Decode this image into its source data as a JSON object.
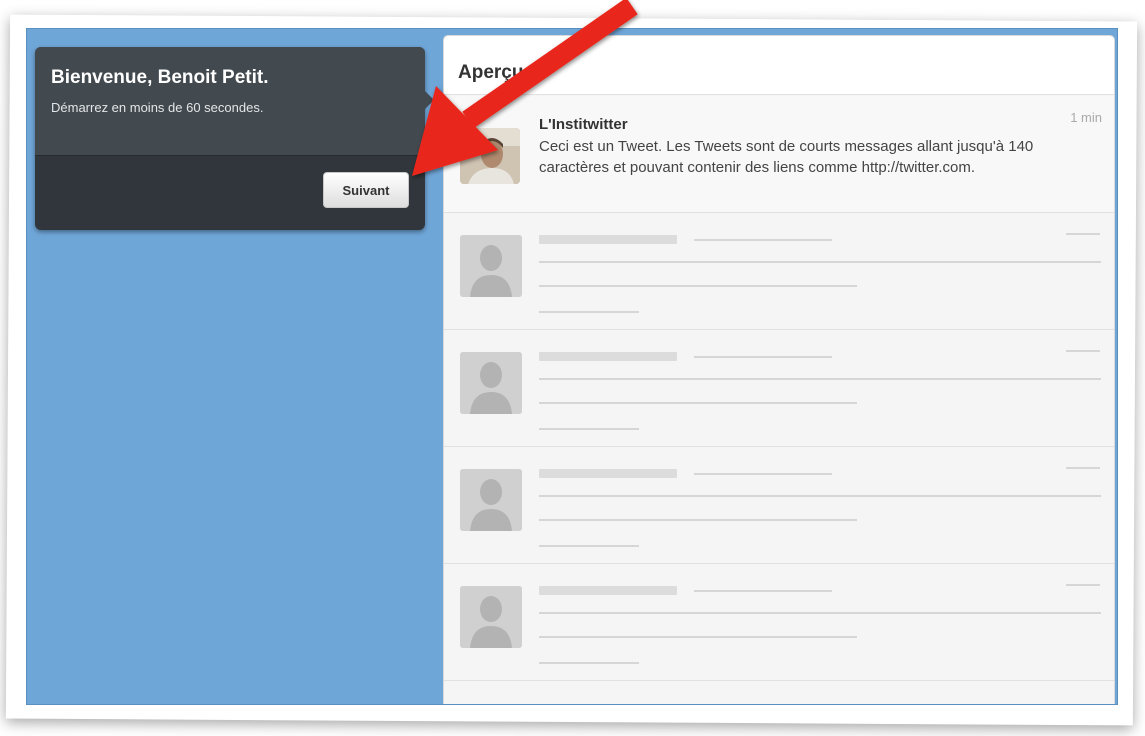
{
  "welcome": {
    "title": "Bienvenue, Benoit Petit.",
    "subtitle": "Démarrez en moins de 60 secondes.",
    "next_label": "Suivant"
  },
  "preview": {
    "title": "Aperçu",
    "tweet": {
      "author": "L'Institwitter",
      "time": "1 min",
      "text": "Ceci est un Tweet. Les Tweets sont de courts messages allant jusqu'à 140 caractères et pouvant contenir des liens comme http://twitter.com."
    },
    "placeholder_count": 4
  },
  "colors": {
    "background_blue": "#6fa6d8",
    "bubble_dark": "#30363b",
    "arrow_red": "#e8281a"
  },
  "icons": [
    "default-avatar-icon",
    "red-arrow-annotation"
  ]
}
